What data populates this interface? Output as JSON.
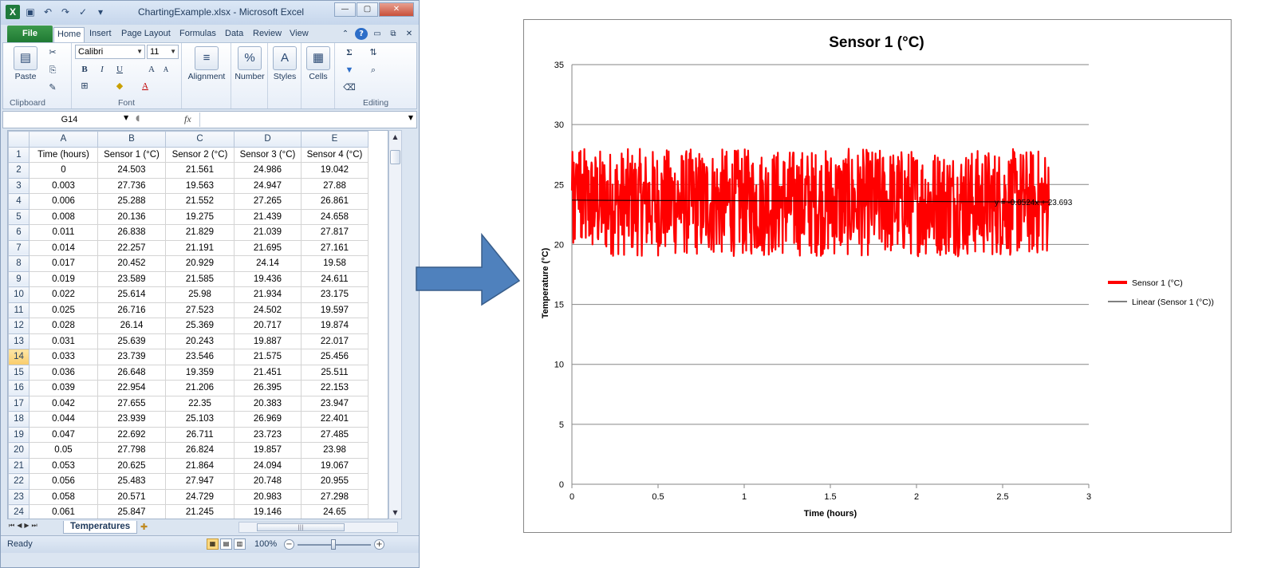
{
  "window": {
    "title": "ChartingExample.xlsx - Microsoft Excel",
    "quick_access": [
      "save-icon",
      "undo-icon",
      "redo-icon",
      "spelling-icon",
      "customize-icon"
    ]
  },
  "ribbon": {
    "file_tab": "File",
    "tabs": [
      "Home",
      "Insert",
      "Page Layout",
      "Formulas",
      "Data",
      "Review",
      "View"
    ],
    "active_tab": "Home",
    "clipboard": {
      "paste_label": "Paste",
      "group_label": "Clipboard"
    },
    "font": {
      "name": "Calibri",
      "size": "11",
      "group_label": "Font",
      "bold": "B",
      "italic": "I",
      "underline": "U"
    },
    "alignment_label": "Alignment",
    "number_label": "Number",
    "styles_label": "Styles",
    "cells_label": "Cells",
    "editing_label": "Editing"
  },
  "formula_bar": {
    "name_box": "G14",
    "fx_label": "fx",
    "formula": ""
  },
  "sheet": {
    "columns": [
      "A",
      "B",
      "C",
      "D",
      "E"
    ],
    "selected_row": 14,
    "rows": [
      [
        "1",
        "Time (hours)",
        "Sensor 1 (°C)",
        "Sensor 2 (°C)",
        "Sensor 3 (°C)",
        "Sensor 4 (°C)"
      ],
      [
        "2",
        "0",
        "24.503",
        "21.561",
        "24.986",
        "19.042"
      ],
      [
        "3",
        "0.003",
        "27.736",
        "19.563",
        "24.947",
        "27.88"
      ],
      [
        "4",
        "0.006",
        "25.288",
        "21.552",
        "27.265",
        "26.861"
      ],
      [
        "5",
        "0.008",
        "20.136",
        "19.275",
        "21.439",
        "24.658"
      ],
      [
        "6",
        "0.011",
        "26.838",
        "21.829",
        "21.039",
        "27.817"
      ],
      [
        "7",
        "0.014",
        "22.257",
        "21.191",
        "21.695",
        "27.161"
      ],
      [
        "8",
        "0.017",
        "20.452",
        "20.929",
        "24.14",
        "19.58"
      ],
      [
        "9",
        "0.019",
        "23.589",
        "21.585",
        "19.436",
        "24.611"
      ],
      [
        "10",
        "0.022",
        "25.614",
        "25.98",
        "21.934",
        "23.175"
      ],
      [
        "11",
        "0.025",
        "26.716",
        "27.523",
        "24.502",
        "19.597"
      ],
      [
        "12",
        "0.028",
        "26.14",
        "25.369",
        "20.717",
        "19.874"
      ],
      [
        "13",
        "0.031",
        "25.639",
        "20.243",
        "19.887",
        "22.017"
      ],
      [
        "14",
        "0.033",
        "23.739",
        "23.546",
        "21.575",
        "25.456"
      ],
      [
        "15",
        "0.036",
        "26.648",
        "19.359",
        "21.451",
        "25.511"
      ],
      [
        "16",
        "0.039",
        "22.954",
        "21.206",
        "26.395",
        "22.153"
      ],
      [
        "17",
        "0.042",
        "27.655",
        "22.35",
        "20.383",
        "23.947"
      ],
      [
        "18",
        "0.044",
        "23.939",
        "25.103",
        "26.969",
        "22.401"
      ],
      [
        "19",
        "0.047",
        "22.692",
        "26.711",
        "23.723",
        "27.485"
      ],
      [
        "20",
        "0.05",
        "27.798",
        "26.824",
        "19.857",
        "23.98"
      ],
      [
        "21",
        "0.053",
        "20.625",
        "21.864",
        "24.094",
        "19.067"
      ],
      [
        "22",
        "0.056",
        "25.483",
        "27.947",
        "20.748",
        "20.955"
      ],
      [
        "23",
        "0.058",
        "20.571",
        "24.729",
        "20.983",
        "27.298"
      ],
      [
        "24",
        "0.061",
        "25.847",
        "21.245",
        "19.146",
        "24.65"
      ]
    ],
    "sheet_tab": "Temperatures"
  },
  "status_bar": {
    "ready": "Ready",
    "zoom": "100%"
  },
  "colors": {
    "arrow": "#4f81bd",
    "series": "#ff0000",
    "trend": "#000000",
    "excel_green": "#1f7a3c"
  },
  "chart_data": {
    "type": "line",
    "title": "Sensor 1 (°C)",
    "xlabel": "Time (hours)",
    "ylabel": "Temperature (°C)",
    "xlim": [
      0,
      3
    ],
    "ylim": [
      0,
      35
    ],
    "xticks": [
      "0",
      "0.5",
      "1",
      "1.5",
      "2",
      "2.5",
      "3"
    ],
    "yticks": [
      "0",
      "5",
      "10",
      "15",
      "20",
      "25",
      "30",
      "35"
    ],
    "grid": "horizontal",
    "legend_position": "right",
    "series": [
      {
        "name": "Sensor 1 (°C)",
        "x_range": [
          0,
          2.77
        ],
        "x_step": 0.00278,
        "y_min": 19.0,
        "y_max": 28.0,
        "sample_x": [
          0,
          0.003,
          0.006,
          0.008,
          0.011,
          0.014,
          0.017,
          0.019,
          0.022,
          0.025,
          0.028,
          0.031,
          0.033,
          0.036,
          0.039,
          0.042,
          0.044,
          0.047,
          0.05,
          0.053,
          0.056,
          0.058,
          0.061
        ],
        "sample_y": [
          24.503,
          27.736,
          25.288,
          20.136,
          26.838,
          22.257,
          20.452,
          23.589,
          25.614,
          26.716,
          26.14,
          25.639,
          23.739,
          26.648,
          22.954,
          27.655,
          23.939,
          22.692,
          27.798,
          20.625,
          25.483,
          20.571,
          25.847
        ]
      },
      {
        "name": "Linear (Sensor 1 (°C))",
        "type": "trendline",
        "slope": -0.0524,
        "intercept": 23.693,
        "x_range": [
          0,
          2.77
        ],
        "equation": "y = -0.0524x + 23.693"
      }
    ]
  }
}
